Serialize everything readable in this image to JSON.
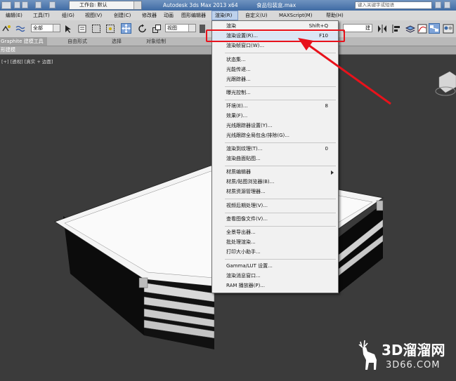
{
  "title_bar": {
    "workspace_label": "工作台: 默认",
    "app_name": "Autodesk 3ds Max  2013 x64",
    "file_name": "食品包装盒.max",
    "search_placeholder": "键入关键字或短语"
  },
  "menu_bar": [
    {
      "label": "编辑(E)"
    },
    {
      "label": "工具(T)"
    },
    {
      "label": "组(G)"
    },
    {
      "label": "视图(V)"
    },
    {
      "label": "创建(C)"
    },
    {
      "label": "修改器"
    },
    {
      "label": "动画"
    },
    {
      "label": "图形编辑器"
    },
    {
      "label": "渲染(R)",
      "active": true
    },
    {
      "label": "自定义(U)"
    },
    {
      "label": "MAXScript(M)"
    },
    {
      "label": "帮助(H)"
    }
  ],
  "toolbar": {
    "selection_filter": "全部",
    "reference_coord": "视图",
    "named_selection_tail": "建"
  },
  "ribbon": {
    "tabs": [
      "Graphite 建模工具",
      "自由形式",
      "选择",
      "对象绘制"
    ],
    "panel_label": "形建模"
  },
  "viewport": {
    "label": "[+] [透视] [真实 + 边面]"
  },
  "render_menu": {
    "groups": [
      [
        {
          "label": "渲染",
          "shortcut": "Shift+Q"
        },
        {
          "label": "渲染设置(R)...",
          "shortcut": "F10",
          "highlighted": true
        },
        {
          "label": "渲染帧窗口(W)...",
          "shortcut": ""
        }
      ],
      [
        {
          "label": "状态集...",
          "shortcut": ""
        },
        {
          "label": "光能传递...",
          "shortcut": ""
        },
        {
          "label": "光跟踪器...",
          "shortcut": ""
        }
      ],
      [
        {
          "label": "曝光控制...",
          "shortcut": ""
        }
      ],
      [
        {
          "label": "环境(E)...",
          "shortcut": "8"
        },
        {
          "label": "效果(F)...",
          "shortcut": ""
        },
        {
          "label": "光线跟踪器设置(Y)...",
          "shortcut": ""
        },
        {
          "label": "光线跟踪全局包含/排除(G)...",
          "shortcut": ""
        }
      ],
      [
        {
          "label": "渲染到纹理(T)...",
          "shortcut": "0"
        },
        {
          "label": "渲染曲面贴图...",
          "shortcut": ""
        }
      ],
      [
        {
          "label": "材质编辑器",
          "shortcut": "",
          "submenu": true
        },
        {
          "label": "材质/贴图浏览器(B)...",
          "shortcut": ""
        },
        {
          "label": "材质资源管理器...",
          "shortcut": ""
        }
      ],
      [
        {
          "label": "视频后期处理(V)...",
          "shortcut": ""
        }
      ],
      [
        {
          "label": "查看图像文件(V)...",
          "shortcut": ""
        }
      ],
      [
        {
          "label": "全景导出器...",
          "shortcut": ""
        },
        {
          "label": "批处理渲染...",
          "shortcut": ""
        },
        {
          "label": "打印大小助手...",
          "shortcut": ""
        }
      ],
      [
        {
          "label": "Gamma/LUT 设置...",
          "shortcut": ""
        },
        {
          "label": "渲染消息窗口...",
          "shortcut": ""
        },
        {
          "label": "RAM 播放器(P)...",
          "shortcut": ""
        }
      ]
    ]
  },
  "colors": {
    "annotation_red": "#e8121b",
    "menu_active": "#bdd1ec",
    "title_blue": "#3f6ba3"
  },
  "watermark": {
    "main": "3D溜溜网",
    "sub": "3D66.COM"
  }
}
